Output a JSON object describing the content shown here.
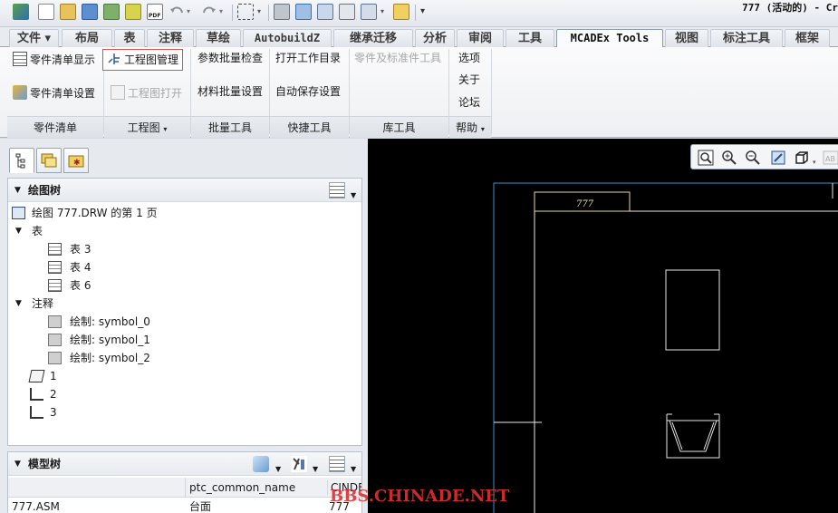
{
  "window": {
    "title": "777 (活动的) - Cr"
  },
  "ribbon_tabs": [
    "文件",
    "布局",
    "表",
    "注释",
    "草绘",
    "AutobuildZ",
    "继承迁移",
    "分析",
    "审阅",
    "工具",
    "MCADEx Tools",
    "视图",
    "标注工具",
    "框架"
  ],
  "ribbon_active_tab": "MCADEx Tools",
  "ribbon": {
    "parts_list_show": "零件清单显示",
    "parts_list_settings": "零件清单设置",
    "drawing_manage": "工程图管理",
    "drawing_open": "工程图打开",
    "param_batch_check": "参数批量检查",
    "material_batch_settings": "材料批量设置",
    "open_work_dir": "打开工作目录",
    "autosave_settings": "自动保存设置",
    "parts_std_tool": "零件及标准件工具",
    "options": "选项",
    "about": "关于",
    "forum": "论坛",
    "groups": [
      "零件清单",
      "工程图",
      "批量工具",
      "快捷工具",
      "库工具",
      "帮助"
    ]
  },
  "drawing_tree": {
    "title": "绘图树",
    "root": "绘图 777.DRW 的第 1 页",
    "tables_label": "表",
    "tables": [
      "表 3",
      "表 4",
      "表 6"
    ],
    "notes_label": "注释",
    "notes": [
      "绘制: symbol_0",
      "绘制: symbol_1",
      "绘制: symbol_2"
    ],
    "views": [
      "1",
      "2",
      "3"
    ]
  },
  "model_tree": {
    "title": "模型树",
    "columns": [
      "",
      "ptc_common_name",
      "CINDEX"
    ],
    "rows": [
      {
        "name": "777.ASM",
        "common_name": "台面",
        "cindex": "777"
      }
    ]
  },
  "graphics": {
    "title_block_text": "777"
  },
  "watermark": "BBS.CHINADE.NET"
}
